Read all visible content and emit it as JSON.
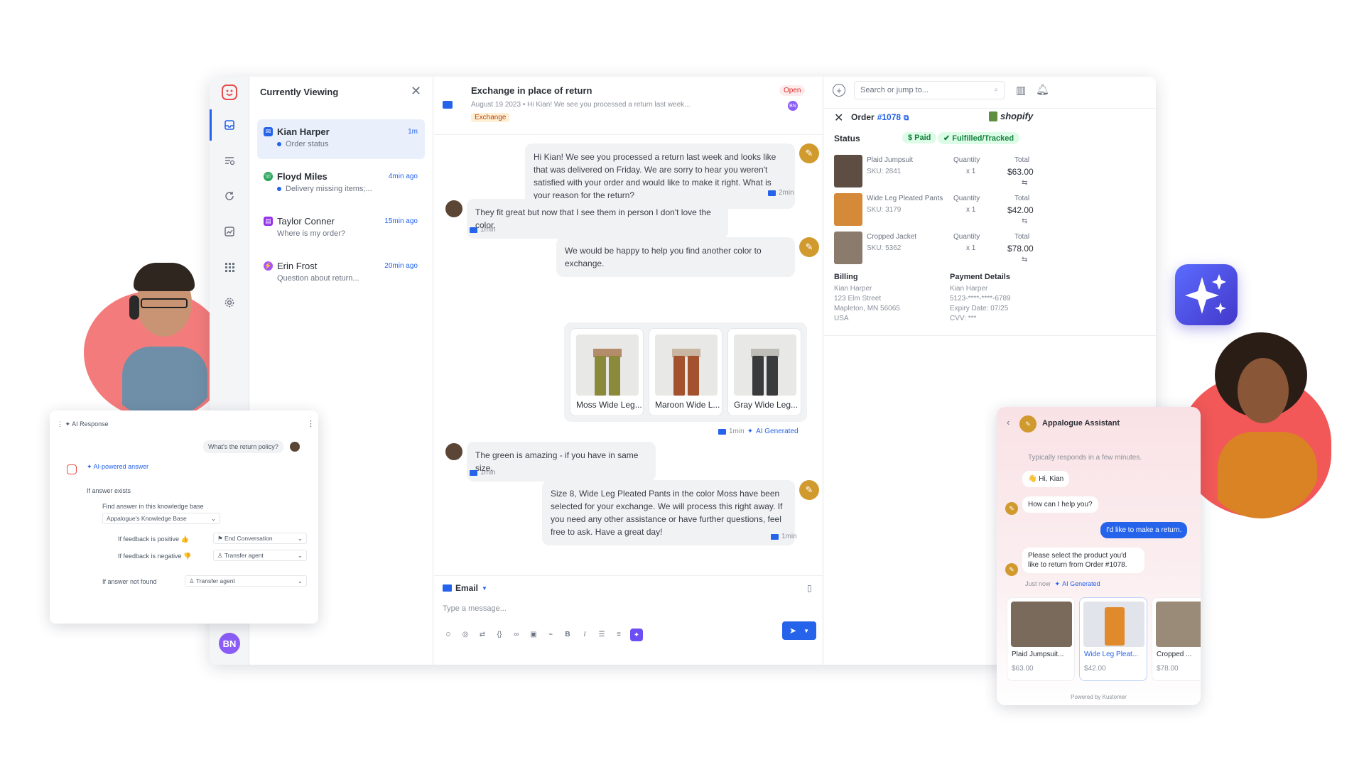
{
  "list": {
    "title": "Currently Viewing",
    "conversations": [
      {
        "name": "Kian Harper",
        "time": "1m",
        "snippet": "Order status",
        "channel": "email"
      },
      {
        "name": "Floyd Miles",
        "time": "4min ago",
        "snippet": "Delivery missing items;...",
        "channel": "whatsapp"
      },
      {
        "name": "Taylor Conner",
        "time": "15min ago",
        "snippet": "Where is my order?",
        "channel": "chat"
      },
      {
        "name": "Erin Frost",
        "time": "20min ago",
        "snippet": "Question about return...",
        "channel": "messenger"
      }
    ]
  },
  "user": {
    "initials": "BN"
  },
  "chat": {
    "subject": "Exchange in place of return",
    "meta": "August 19 2023  •  Hi Kian! We see you processed a return last week...",
    "tag": "Exchange",
    "status": "Open",
    "assignee": "BN",
    "messages": [
      {
        "text": "Hi Kian! We see you processed a return last week and looks like that was delivered on Friday. We are sorry to hear you weren't satisfied with your order and would like to make it right. What is your reason for the return?",
        "time": "2min"
      },
      {
        "text": "They fit great but now that I see them in person I don't love the color.",
        "time": "1min"
      },
      {
        "text": "We would be happy to help you find another color to exchange.",
        "time": ""
      },
      {
        "text": "The green is amazing - if you have in same size.",
        "time": "1min"
      },
      {
        "text": "Size 8, Wide Leg Pleated Pants in the color Moss have been selected for your exchange. We will process this right away. If you need any other assistance or have further questions, feel free to ask. Have a great day!",
        "time": "1min"
      }
    ],
    "products": [
      {
        "label": "Moss Wide Leg...",
        "color": "#8a8a3a"
      },
      {
        "label": "Maroon Wide L...",
        "color": "#a4512e"
      },
      {
        "label": "Gray Wide Leg...",
        "color": "#3a3b3d"
      }
    ],
    "products_time": "1min",
    "ai_generated": "AI Generated",
    "composer": {
      "channel": "Email",
      "placeholder": "Type a message..."
    }
  },
  "order": {
    "search_placeholder": "Search or jump to...",
    "title": "Order",
    "number": "#1078",
    "platform": "shopify",
    "status_label": "Status",
    "paid": "$ Paid",
    "fulfilled": "Fulfilled/Tracked",
    "items": [
      {
        "name": "Plaid Jumpsuit",
        "sku": "SKU: 2841",
        "qty_label": "Quantity",
        "qty": "x 1",
        "total_label": "Total",
        "total": "$63.00"
      },
      {
        "name": "Wide Leg Pleated Pants",
        "sku": "SKU: 3179",
        "qty_label": "Quantity",
        "qty": "x 1",
        "total_label": "Total",
        "total": "$42.00"
      },
      {
        "name": "Cropped Jacket",
        "sku": "SKU: 5362",
        "qty_label": "Quantity",
        "qty": "x 1",
        "total_label": "Total",
        "total": "$78.00"
      }
    ],
    "billing": {
      "label": "Billing",
      "text": "Kian Harper\n123 Elm Street\nMapleton, MN 56065\nUSA"
    },
    "payment": {
      "label": "Payment Details",
      "text": "Kian Harper\n5123-****-****-6789\nExpiry Date: 07/25\nCVV: ***"
    }
  },
  "ai_card": {
    "title": "AI Response",
    "question": "What's the return policy?",
    "answer_label": "AI-powered answer",
    "if_exists": "If answer exists",
    "find_answer": "Find answer in this knowledge base",
    "kb": "Appalogue's Knowledge Base",
    "positive": "If feedback is positive 👍",
    "positive_action": "End Conversation",
    "negative": "If feedback is negative 👎",
    "negative_action": "Transfer agent",
    "not_found": "If answer not found",
    "not_found_action": "Transfer agent"
  },
  "widget": {
    "title": "Appalogue Assistant",
    "subtitle": "Typically responds in a few minutes.",
    "greeting": "👋 Hi, Kian",
    "help": "How can I help you?",
    "user_msg": "I'd like to make a return.",
    "prompt": "Please select the product you'd like to return from Order #1078.",
    "just_now": "Just now",
    "ai_generated": "AI Generated",
    "products": [
      {
        "name": "Plaid Jumpsuit...",
        "price": "$63.00"
      },
      {
        "name": "Wide Leg Pleat...",
        "price": "$42.00"
      },
      {
        "name": "Cropped ...",
        "price": "$78.00"
      }
    ],
    "footer": "Powered by Kustomer"
  },
  "colors": {
    "accent": "#2563eb",
    "bot": "#d19a2e",
    "ai": "#6d4ef5",
    "blob": "#f47b7b"
  }
}
